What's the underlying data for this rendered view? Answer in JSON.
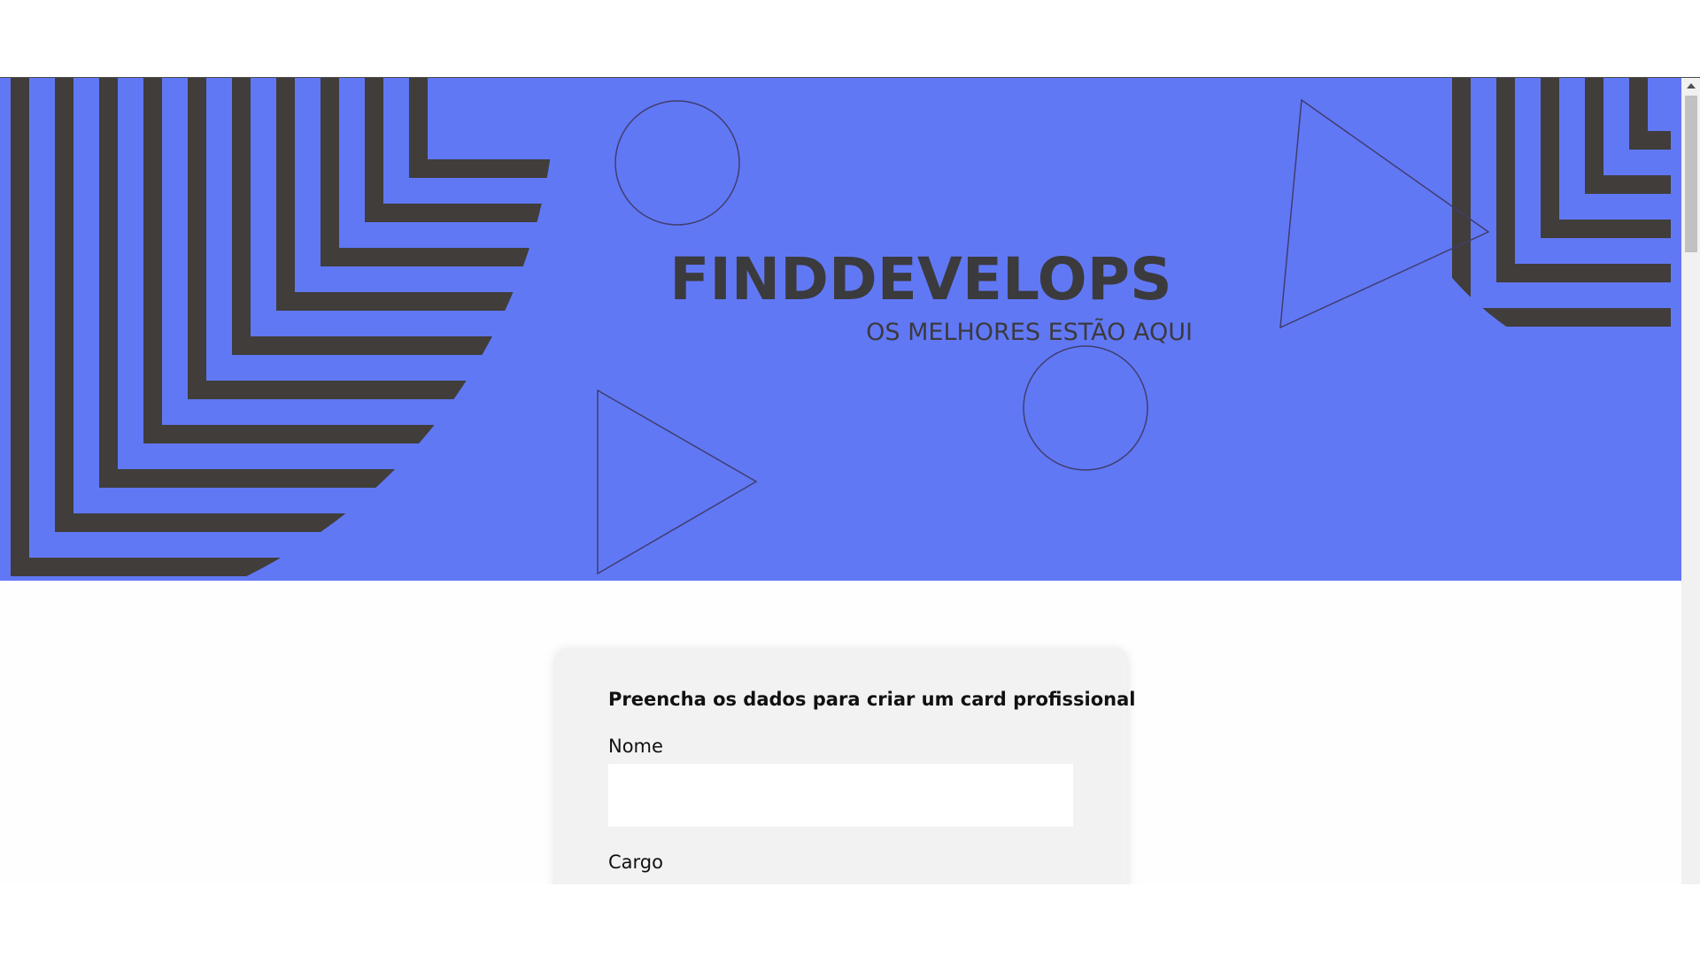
{
  "banner": {
    "title": "FINDDEVELOPS",
    "subtitle": "OS MELHORES ESTÃO AQUI",
    "colors": {
      "background": "#6178f5",
      "stripes": "#403d3b",
      "outline": "#403d6e",
      "title": "#3b3a3d"
    }
  },
  "form": {
    "heading": "Preencha os dados para criar um card profissional",
    "fields": [
      {
        "label": "Nome",
        "value": "",
        "placeholder": ""
      },
      {
        "label": "Cargo",
        "value": "",
        "placeholder": ""
      }
    ]
  },
  "scrollbar": {
    "up_icon": "triangle-up"
  }
}
